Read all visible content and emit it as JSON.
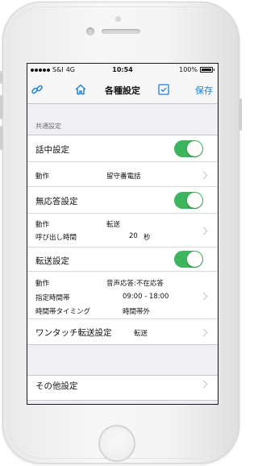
{
  "status_bar": {
    "carrier": "S&I",
    "network": "4G",
    "time": "10:54",
    "battery": "100%"
  },
  "nav": {
    "title": "各種設定",
    "save_label": "保存",
    "icons": [
      "link-icon",
      "home-icon",
      "checkbox-icon"
    ]
  },
  "common": {
    "section_label": "共通設定",
    "busy": {
      "label": "話中設定",
      "enabled": true,
      "action_key": "動作",
      "action_value": "留守番電話"
    },
    "no_answer": {
      "label": "無応答設定",
      "enabled": true,
      "action_key": "動作",
      "action_value": "転送",
      "ring_time_key": "呼び出し時間",
      "ring_time_value": "20",
      "ring_time_unit": "秒"
    },
    "forward": {
      "label": "転送設定",
      "enabled": true,
      "action_key": "動作",
      "action_value": "音声応答:不在応答",
      "time_range_key": "指定時間帯",
      "time_range_value": "09:00 - 18:00",
      "timing_key": "時間帯タイミング",
      "timing_value": "時間帯外"
    },
    "one_touch": {
      "label": "ワンタッチ転送設定",
      "value": "転送"
    }
  },
  "other": {
    "section_label": "その他設定"
  },
  "colors": {
    "accent": "#1a7fd6",
    "toggle_on": "#3db55e",
    "background": "#efeff4"
  }
}
